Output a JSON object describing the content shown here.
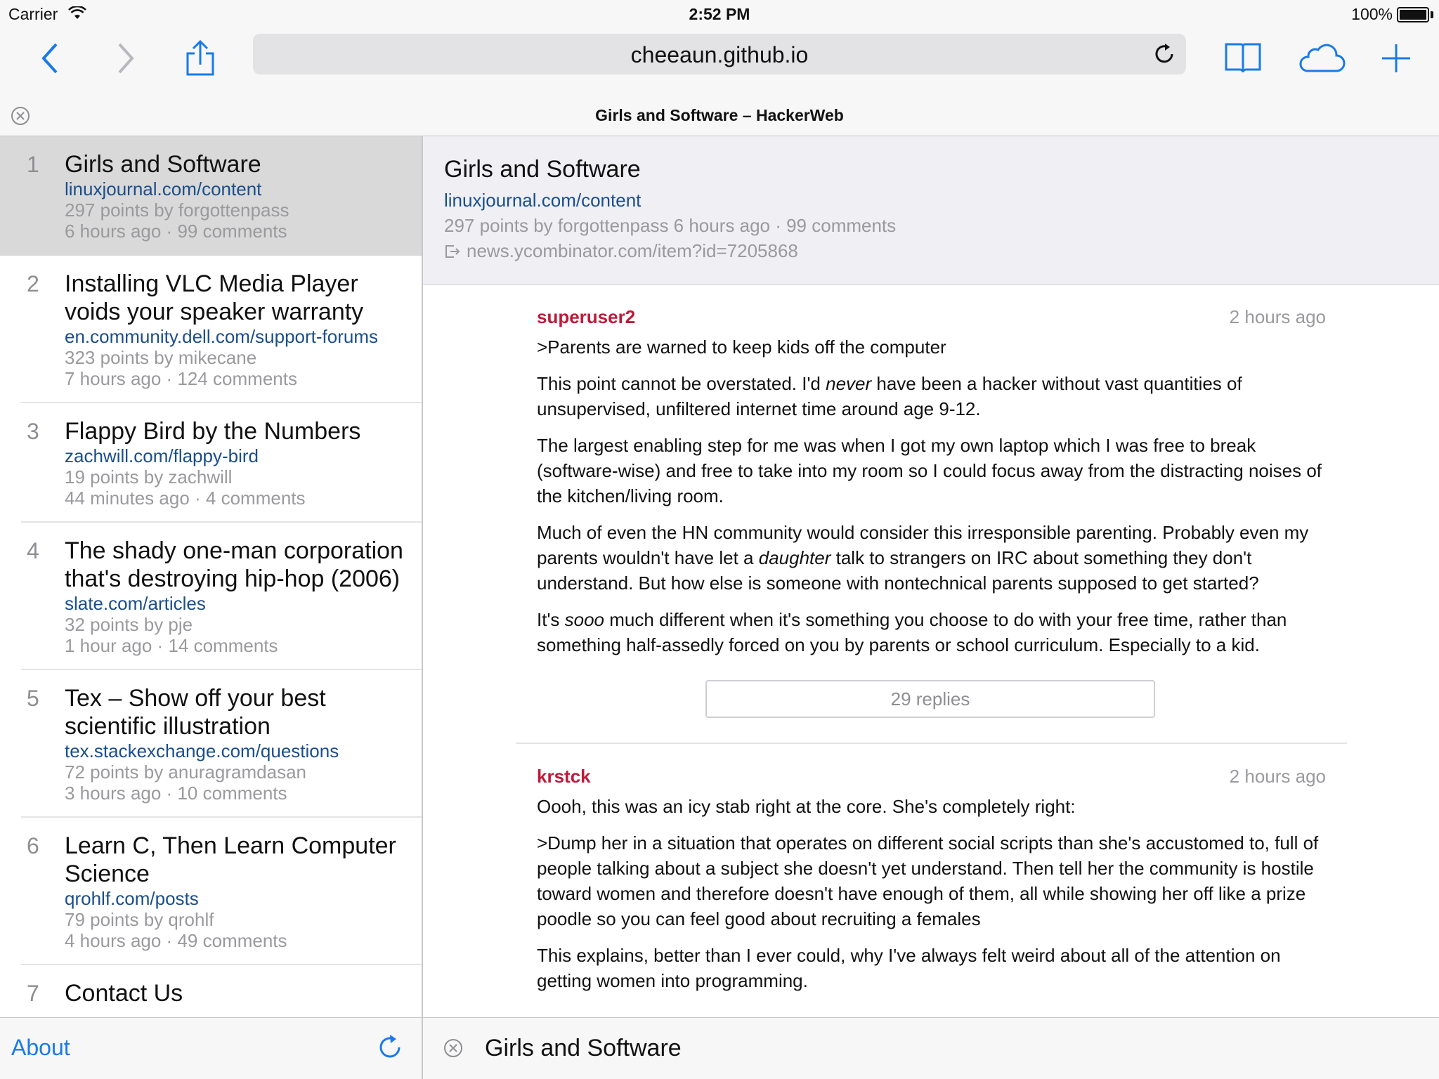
{
  "status_bar": {
    "carrier": "Carrier",
    "time": "2:52 PM",
    "battery": "100%"
  },
  "browser": {
    "url": "cheeaun.github.io",
    "tab_title": "Girls and Software – HackerWeb"
  },
  "stories": [
    {
      "num": "1",
      "title": "Girls and Software",
      "domain": "linuxjournal.com/content",
      "points": "297 points by forgottenpass",
      "time": "6 hours ago",
      "comments": "99 comments"
    },
    {
      "num": "2",
      "title": "Installing VLC Media Player voids your speaker warranty",
      "domain": "en.community.dell.com/support-forums",
      "points": "323 points by mikecane",
      "time": "7 hours ago",
      "comments": "124 comments"
    },
    {
      "num": "3",
      "title": "Flappy Bird by the Numbers",
      "domain": "zachwill.com/flappy-bird",
      "points": "19 points by zachwill",
      "time": "44 minutes ago",
      "comments": "4 comments"
    },
    {
      "num": "4",
      "title": "The shady one-man corporation that's destroying hip-hop (2006)",
      "domain": "slate.com/articles",
      "points": "32 points by pje",
      "time": "1 hour ago",
      "comments": "14 comments"
    },
    {
      "num": "5",
      "title": "Tex – Show off your best scientific illustration",
      "domain": "tex.stackexchange.com/questions",
      "points": "72 points by anuragramdasan",
      "time": "3 hours ago",
      "comments": "10 comments"
    },
    {
      "num": "6",
      "title": "Learn C, Then Learn Computer Science",
      "domain": "qrohlf.com/posts",
      "points": "79 points by qrohlf",
      "time": "4 hours ago",
      "comments": "49 comments"
    },
    {
      "num": "7",
      "title": "Contact Us"
    }
  ],
  "list_footer": {
    "about": "About"
  },
  "detail": {
    "title": "Girls and Software",
    "domain": "linuxjournal.com/content",
    "meta": "297 points by forgottenpass 6 hours ago · 99 comments",
    "hn_link": "news.ycombinator.com/item?id=7205868"
  },
  "comments": [
    {
      "author": "superuser2",
      "time": "2 hours ago",
      "p1": ">Parents are warned to keep kids off the computer",
      "p2a": "This point cannot be overstated. I'd ",
      "p2em": "never",
      "p2b": " have been a hacker without vast quantities of unsupervised, unfiltered internet time around age 9-12.",
      "p3": "The largest enabling step for me was when I got my own laptop which I was free to break (software-wise) and free to take into my room so I could focus away from the distracting noises of the kitchen/living room.",
      "p4a": "Much of even the HN community would consider this irresponsible parenting. Probably even my parents wouldn't have let a ",
      "p4em": "daughter",
      "p4b": " talk to strangers on IRC about something they don't understand. But how else is someone with nontechnical parents supposed to get started?",
      "p5a": "It's ",
      "p5em": "sooo",
      "p5b": " much different when it's something you choose to do with your free time, rather than something half-assedly forced on you by parents or school curriculum. Especially to a kid.",
      "replies": "29 replies"
    },
    {
      "author": "krstck",
      "time": "2 hours ago",
      "p1": "Oooh, this was an icy stab right at the core. She's completely right:",
      "p2": ">Dump her in a situation that operates on different social scripts than she's accustomed to, full of people talking about a subject she doesn't yet understand. Then tell her the community is hostile toward women and therefore doesn't have enough of them, all while showing her off like a prize poodle so you can feel good about recruiting a females",
      "p3": "This explains, better than I ever could, why I've always felt weird about all of the attention on getting women into programming."
    }
  ],
  "detail_footer": {
    "title": "Girls and Software"
  },
  "colors": {
    "accent": "#1a7ae8",
    "link": "#1b4e8a",
    "author": "#be1a3a",
    "muted": "#9a9a9e"
  }
}
